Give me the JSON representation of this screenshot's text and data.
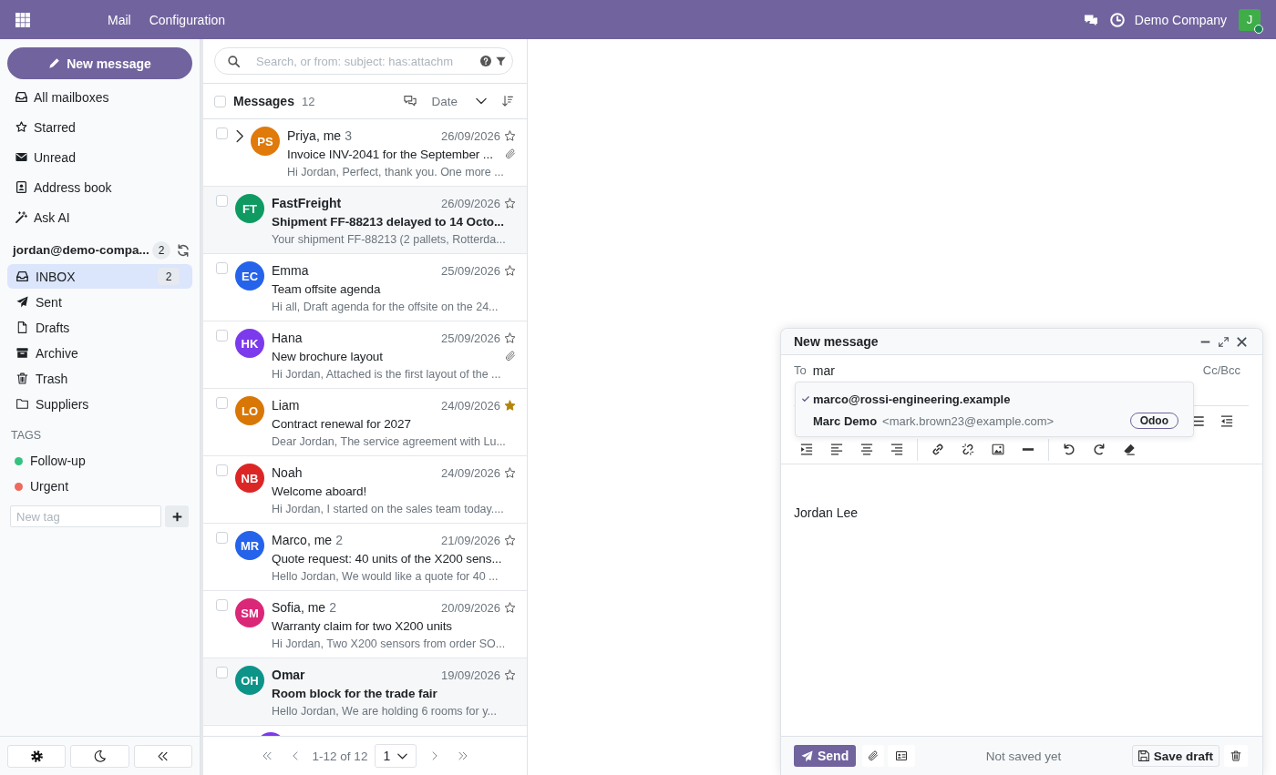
{
  "top_bar": {
    "menu": [
      {
        "label": "Mail"
      },
      {
        "label": "Configuration"
      }
    ],
    "company": "Demo Company",
    "user": {
      "initial": "J",
      "online": true
    }
  },
  "sidebar": {
    "new_message": "New message",
    "mailboxes": [
      {
        "label": "All mailboxes",
        "selected": false
      },
      {
        "label": "Starred",
        "selected": false
      },
      {
        "label": "Unread",
        "selected": false
      },
      {
        "label": "Address book",
        "selected": false
      },
      {
        "label": "Ask AI",
        "selected": false
      }
    ],
    "account": {
      "email": "jordan@demo-compa...",
      "count": "2"
    },
    "folders": [
      {
        "label": "INBOX",
        "count": "2",
        "selected": true
      },
      {
        "label": "Sent",
        "selected": false
      },
      {
        "label": "Drafts",
        "selected": false
      },
      {
        "label": "Archive",
        "selected": false
      },
      {
        "label": "Trash",
        "selected": false
      },
      {
        "label": "Suppliers",
        "selected": false
      }
    ],
    "tags": {
      "heading": "TAGS",
      "items": [
        {
          "label": "Follow-up",
          "color": "#35c27f"
        },
        {
          "label": "Urgent",
          "color": "#ec6a5e"
        }
      ],
      "new_tag_placeholder": "New tag"
    }
  },
  "message_list": {
    "search_placeholder": "Search, or from: subject: has:attachm",
    "select_all_checked": false,
    "heading": "Messages",
    "count": "12",
    "sort_label": "Date",
    "rows": [
      {
        "sender": "Priya, me",
        "thread_count": "3",
        "date": "26/09/2026",
        "subject": "Invoice INV-2041 for the September ...",
        "preview": "Hi Jordan, Perfect, thank you. One more ...",
        "initials": "PS",
        "color": "#df7a0b",
        "checked": false,
        "unread": false,
        "starred": false,
        "has_attachment": true,
        "expandable": true
      },
      {
        "sender": "FastFreight",
        "date": "26/09/2026",
        "subject": "Shipment FF-88213 delayed to 14 Octo...",
        "preview": "Your shipment FF-88213 (2 pallets, Rotterda...",
        "initials": "FT",
        "color": "#0f9a62",
        "checked": false,
        "unread": true,
        "starred": false,
        "has_attachment": false,
        "expandable": false
      },
      {
        "sender": "Emma",
        "date": "25/09/2026",
        "subject": "Team offsite agenda",
        "preview": "Hi all, Draft agenda for the offsite on the 24...",
        "initials": "EC",
        "color": "#2563eb",
        "checked": false,
        "unread": false,
        "starred": false,
        "has_attachment": false,
        "expandable": false
      },
      {
        "sender": "Hana",
        "date": "25/09/2026",
        "subject": "New brochure layout",
        "preview": "Hi Jordan, Attached is the first layout of the ...",
        "initials": "HK",
        "color": "#7c3aed",
        "checked": false,
        "unread": false,
        "starred": false,
        "has_attachment": true,
        "expandable": false
      },
      {
        "sender": "Liam",
        "date": "24/09/2026",
        "subject": "Contract renewal for 2027",
        "preview": "Dear Jordan, The service agreement with Lu...",
        "initials": "LO",
        "color": "#d97706",
        "checked": false,
        "unread": false,
        "starred": true,
        "has_attachment": false,
        "expandable": false
      },
      {
        "sender": "Noah",
        "date": "24/09/2026",
        "subject": "Welcome aboard!",
        "preview": "Hi Jordan, I started on the sales team today....",
        "initials": "NB",
        "color": "#dc2626",
        "checked": false,
        "unread": false,
        "starred": false,
        "has_attachment": false,
        "expandable": false
      },
      {
        "sender": "Marco, me",
        "thread_count": "2",
        "date": "21/09/2026",
        "subject": "Quote request: 40 units of the X200 sens...",
        "preview": "Hello Jordan, We would like a quote for 40 ...",
        "initials": "MR",
        "color": "#2563eb",
        "checked": false,
        "unread": false,
        "starred": false,
        "has_attachment": false,
        "expandable": false
      },
      {
        "sender": "Sofia, me",
        "thread_count": "2",
        "date": "20/09/2026",
        "subject": "Warranty claim for two X200 units",
        "preview": "Hi Jordan, Two X200 sensors from order SO...",
        "initials": "SM",
        "color": "#db2777",
        "checked": false,
        "unread": false,
        "starred": false,
        "has_attachment": false,
        "expandable": false
      },
      {
        "sender": "Omar",
        "date": "19/09/2026",
        "subject": "Room block for the trade fair",
        "preview": "Hello Jordan, We are holding 6 rooms for y...",
        "initials": "OH",
        "color": "#0d9488",
        "checked": false,
        "unread": true,
        "starred": false,
        "has_attachment": false,
        "expandable": false
      }
    ],
    "cut_off_row": {
      "color": "#7c3aed"
    },
    "pagination": {
      "range": "1-12 of 12",
      "page": "1"
    }
  },
  "compose": {
    "title": "New message",
    "to_label": "To",
    "to_value": "mar",
    "cc_bcc": "Cc/Bcc",
    "suggestions": [
      {
        "kind": "address",
        "email": "marco@rossi-engineering.example",
        "selected": true
      },
      {
        "kind": "contact",
        "name": "Marc Demo",
        "email": "<mark.brown23@example.com>",
        "badge": "Odoo",
        "selected": false
      }
    ],
    "signature": "Jordan Lee",
    "send": "Send",
    "status": "Not saved yet",
    "save_draft": "Save draft"
  }
}
